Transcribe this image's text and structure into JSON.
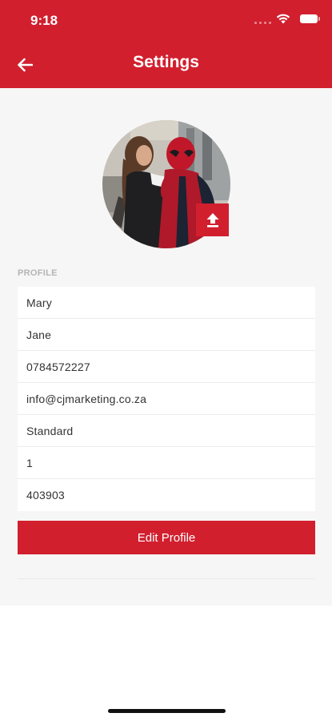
{
  "status_bar": {
    "time": "9:18"
  },
  "header": {
    "title": "Settings",
    "back_icon": "arrow-left-icon"
  },
  "profile": {
    "section_label": "PROFILE",
    "avatar_icon": "profile-photo",
    "upload_icon": "upload-icon",
    "fields": [
      {
        "value": "Mary"
      },
      {
        "value": "Jane"
      },
      {
        "value": "0784572227"
      },
      {
        "value": "info@cjmarketing.co.za"
      },
      {
        "value": "Standard"
      },
      {
        "value": "1"
      },
      {
        "value": "403903"
      }
    ],
    "edit_button": "Edit Profile"
  },
  "colors": {
    "accent": "#d11f2e",
    "background": "#f6f6f6",
    "card": "#ffffff",
    "label": "#b4b4b4"
  }
}
